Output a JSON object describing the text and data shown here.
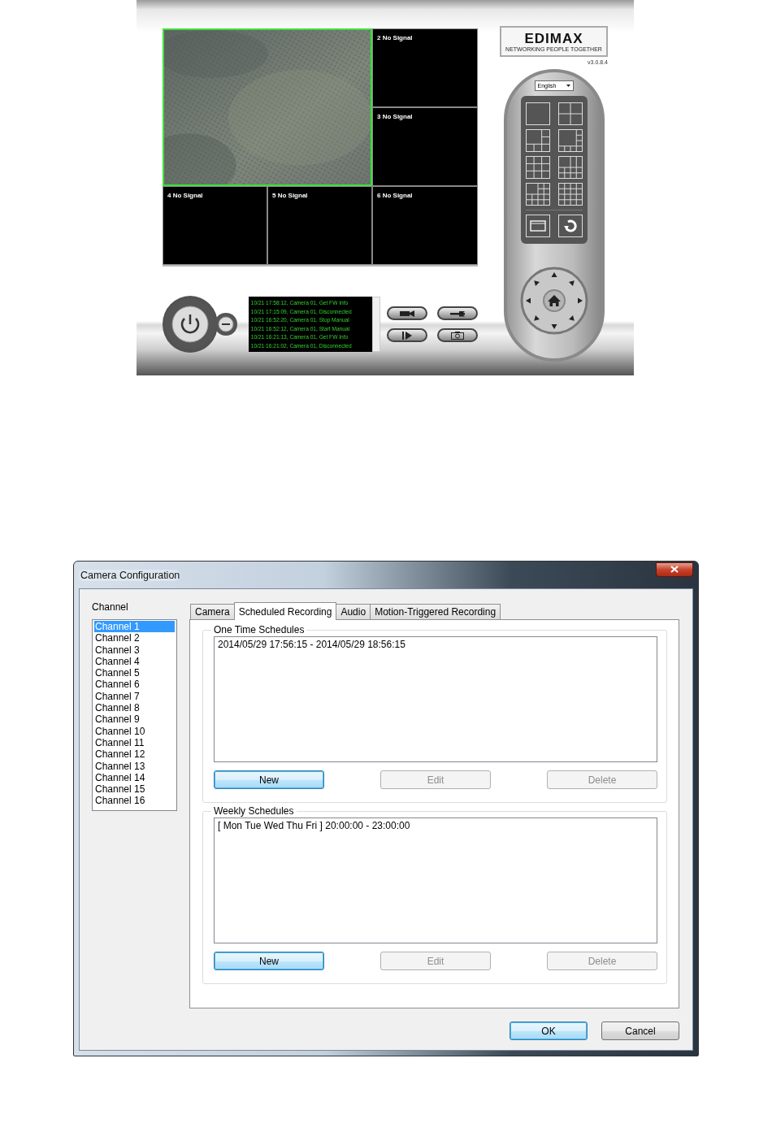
{
  "app": {
    "logo": {
      "name": "EDIMAX",
      "tagline": "NETWORKING PEOPLE TOGETHER"
    },
    "version": "v3.0.8.4",
    "language": "English",
    "video_cells": [
      {
        "kind": "picture",
        "selected": true
      },
      {
        "kind": "empty",
        "label": "2 No Signal",
        "selected": false
      },
      {
        "kind": "empty",
        "label": "3 No Signal",
        "selected": false
      },
      {
        "kind": "empty",
        "label": "4 No Signal",
        "selected": false
      },
      {
        "kind": "empty",
        "label": "5 No Signal",
        "selected": false
      },
      {
        "kind": "empty",
        "label": "6 No Signal",
        "selected": false
      }
    ],
    "log": [
      "10/21 17:58:12, Camera 01, Get FW Info",
      "10/21 17:15:09, Camera 01, Disconnected",
      "10/21 16:52:20, Camera 01, Stop Manual",
      "10/21 16:52:12, Camera 01, Start Manual",
      "10/21 16:21:13, Camera 01, Get FW Info",
      "10/21 16:21:02, Camera 01, Disconnected"
    ]
  },
  "dialog": {
    "title": "Camera Configuration",
    "channel_label": "Channel",
    "channels": [
      {
        "label": "Channel 1",
        "selected": true
      },
      {
        "label": "Channel 2",
        "selected": false
      },
      {
        "label": "Channel 3",
        "selected": false
      },
      {
        "label": "Channel 4",
        "selected": false
      },
      {
        "label": "Channel 5",
        "selected": false
      },
      {
        "label": "Channel 6",
        "selected": false
      },
      {
        "label": "Channel 7",
        "selected": false
      },
      {
        "label": "Channel 8",
        "selected": false
      },
      {
        "label": "Channel 9",
        "selected": false
      },
      {
        "label": "Channel 10",
        "selected": false
      },
      {
        "label": "Channel 11",
        "selected": false
      },
      {
        "label": "Channel 12",
        "selected": false
      },
      {
        "label": "Channel 13",
        "selected": false
      },
      {
        "label": "Channel 14",
        "selected": false
      },
      {
        "label": "Channel 15",
        "selected": false
      },
      {
        "label": "Channel 16",
        "selected": false
      }
    ],
    "tabs": [
      {
        "label": "Camera",
        "selected": false
      },
      {
        "label": "Scheduled Recording",
        "selected": true
      },
      {
        "label": "Audio",
        "selected": false
      },
      {
        "label": "Motion-Triggered Recording",
        "selected": false
      }
    ],
    "groups": [
      {
        "title": "One Time Schedules",
        "entries": [
          "2014/05/29 17:56:15 - 2014/05/29 18:56:15"
        ],
        "buttons": [
          {
            "label": "New",
            "disabled": false,
            "focused": true
          },
          {
            "label": "Edit",
            "disabled": true,
            "focused": false
          },
          {
            "label": "Delete",
            "disabled": true,
            "focused": false
          }
        ]
      },
      {
        "title": "Weekly Schedules",
        "entries": [
          "[ Mon Tue Wed Thu Fri ] 20:00:00 - 23:00:00"
        ],
        "buttons": [
          {
            "label": "New",
            "disabled": false,
            "focused": true
          },
          {
            "label": "Edit",
            "disabled": true,
            "focused": false
          },
          {
            "label": "Delete",
            "disabled": true,
            "focused": false
          }
        ]
      }
    ],
    "buttons": [
      {
        "label": "OK",
        "focused": true
      },
      {
        "label": "Cancel",
        "focused": false
      }
    ]
  }
}
